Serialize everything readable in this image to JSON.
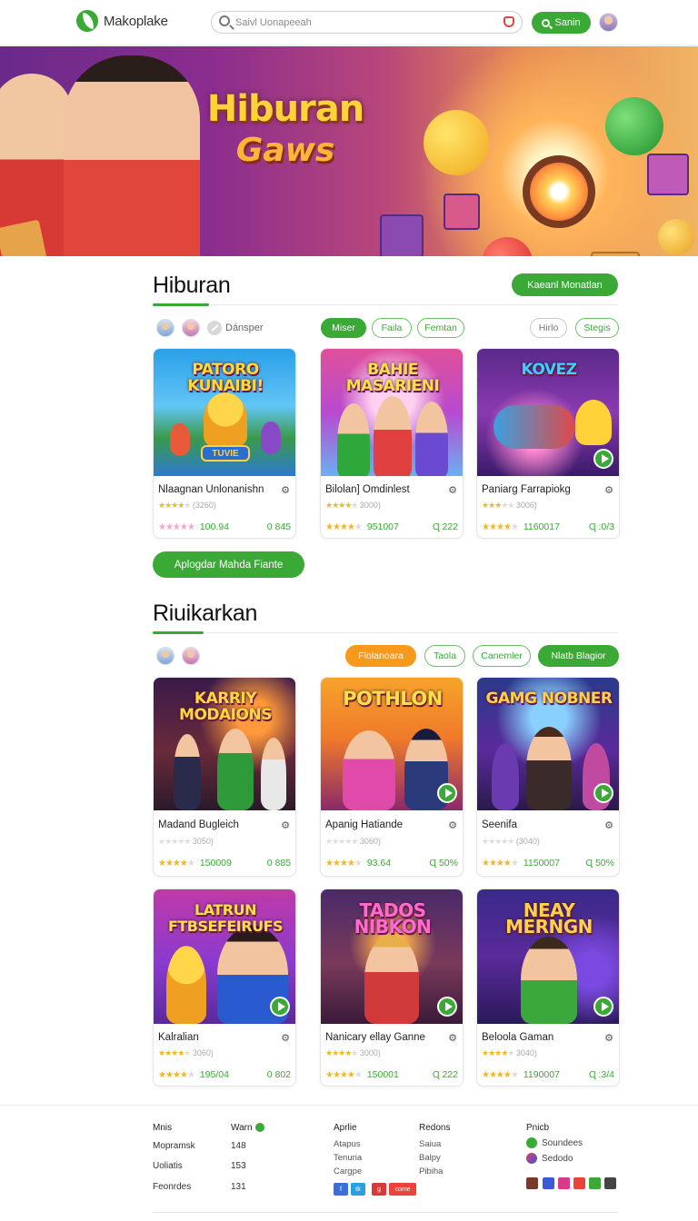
{
  "header": {
    "logo_text": "Makoplake",
    "search_placeholder": "Saivl Uonapeeah",
    "signin_label": "Sanin"
  },
  "hero": {
    "title_line1": "Hiburan",
    "title_line2": "Gaws"
  },
  "section1": {
    "title": "Hiburan",
    "cta_label": "Kaeanl Monatlan",
    "filter_label": "Dánsper",
    "chips": [
      {
        "label": "Miser",
        "style": "active"
      },
      {
        "label": "Faila",
        "style": "outline"
      },
      {
        "label": "Femtan",
        "style": "outline"
      },
      {
        "label": "Hirlo",
        "style": "grey"
      },
      {
        "label": "Stegis",
        "style": "outline"
      }
    ],
    "cards": [
      {
        "thumb_title": "PATORO KUNAIBI!",
        "thumb_sub": "TUVIE",
        "name": "Nlaagnan Unlonanishn",
        "sub": "(3260)",
        "rating": 4,
        "count": "100.94",
        "price": "0 845"
      },
      {
        "thumb_title": "BAHIE MASARIENI",
        "thumb_sub": "",
        "name": "Bilolan] Omdinlest",
        "sub": "3000)",
        "rating": 4,
        "count": "951007",
        "price": "Ɋ 222"
      },
      {
        "thumb_title": "KOVEZ",
        "thumb_sub": "",
        "name": "Paniarg Farrapiokg",
        "sub": "3006)",
        "rating": 3,
        "count": "1160017",
        "price": "Ɋ :0/3"
      }
    ],
    "load_more_label": "Aplogdar Mahda Fiante"
  },
  "section2": {
    "title": "Riuikarkan",
    "chips": [
      {
        "label": "Flolanoara",
        "style": "orange"
      },
      {
        "label": "Taola",
        "style": "outline"
      },
      {
        "label": "Canemler",
        "style": "outline"
      },
      {
        "label": "Nlatb Blagior",
        "style": "active"
      }
    ],
    "cards": [
      {
        "thumb_title": "KARRIY MODAIONS",
        "name": "Madand Bugleich",
        "sub": "3050)",
        "rating": 4,
        "count": "150009",
        "price": "0 885"
      },
      {
        "thumb_title": "POTHLON",
        "name": "Apanig Hatiande",
        "sub": "3060)",
        "rating": 4,
        "count": "93.64",
        "price": "Ɋ 50%"
      },
      {
        "thumb_title": "GAMG NOBNER",
        "name": "Seenifa",
        "sub": "(3040)",
        "rating": 4,
        "count": "1150007",
        "price": "Ɋ 50%"
      },
      {
        "thumb_title": "LATRUN FTBSEFEIRUFS",
        "name": "Kalralian",
        "sub": "3060)",
        "rating": 4,
        "count": "195/04",
        "price": "0 802"
      },
      {
        "thumb_title": "TADOS NIBKON",
        "name": "Nanicary ellay Ganne",
        "sub": "3000)",
        "rating": 4,
        "count": "150001",
        "price": "Ɋ 222"
      },
      {
        "thumb_title": "NEAY MERNGN",
        "name": "Beloola Gaman",
        "sub": "3040)",
        "rating": 4,
        "count": "1190007",
        "price": "Ɋ :3/4"
      }
    ]
  },
  "footer": {
    "col1": {
      "head": "Mnis",
      "items": [
        "Mopramsk",
        "Uoliatis",
        "Feonrdes"
      ]
    },
    "col2": {
      "head": "Warn",
      "items": [
        "148",
        "153",
        "131"
      ]
    },
    "col3": {
      "head": "Aprlie",
      "items": [
        "Atapus",
        "Tenuria",
        "Cargpe"
      ]
    },
    "col4": {
      "head": "Redons",
      "items": [
        "Saiua",
        "Balpy",
        "Pibiha"
      ]
    },
    "col5": {
      "head": "Pnicb",
      "apps": [
        "Soundees",
        "Sedodo"
      ]
    },
    "social": [
      "f",
      "tk",
      "g",
      "come"
    ]
  }
}
